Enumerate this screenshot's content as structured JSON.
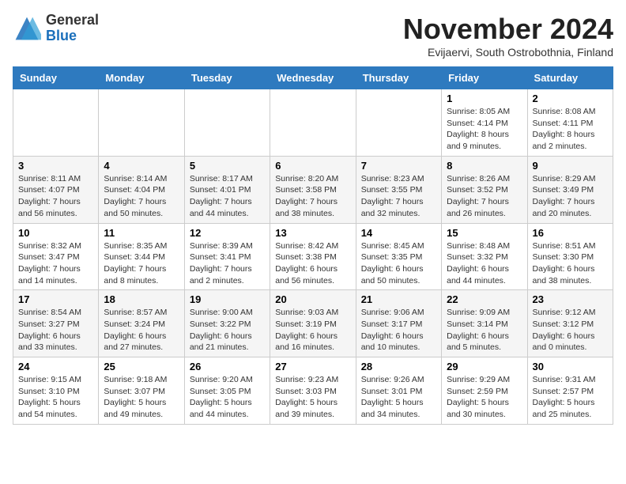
{
  "logo": {
    "general": "General",
    "blue": "Blue"
  },
  "title": "November 2024",
  "subtitle": "Evijaervi, South Ostrobothnia, Finland",
  "days_of_week": [
    "Sunday",
    "Monday",
    "Tuesday",
    "Wednesday",
    "Thursday",
    "Friday",
    "Saturday"
  ],
  "weeks": [
    [
      {
        "day": "",
        "info": ""
      },
      {
        "day": "",
        "info": ""
      },
      {
        "day": "",
        "info": ""
      },
      {
        "day": "",
        "info": ""
      },
      {
        "day": "",
        "info": ""
      },
      {
        "day": "1",
        "info": "Sunrise: 8:05 AM\nSunset: 4:14 PM\nDaylight: 8 hours and 9 minutes."
      },
      {
        "day": "2",
        "info": "Sunrise: 8:08 AM\nSunset: 4:11 PM\nDaylight: 8 hours and 2 minutes."
      }
    ],
    [
      {
        "day": "3",
        "info": "Sunrise: 8:11 AM\nSunset: 4:07 PM\nDaylight: 7 hours and 56 minutes."
      },
      {
        "day": "4",
        "info": "Sunrise: 8:14 AM\nSunset: 4:04 PM\nDaylight: 7 hours and 50 minutes."
      },
      {
        "day": "5",
        "info": "Sunrise: 8:17 AM\nSunset: 4:01 PM\nDaylight: 7 hours and 44 minutes."
      },
      {
        "day": "6",
        "info": "Sunrise: 8:20 AM\nSunset: 3:58 PM\nDaylight: 7 hours and 38 minutes."
      },
      {
        "day": "7",
        "info": "Sunrise: 8:23 AM\nSunset: 3:55 PM\nDaylight: 7 hours and 32 minutes."
      },
      {
        "day": "8",
        "info": "Sunrise: 8:26 AM\nSunset: 3:52 PM\nDaylight: 7 hours and 26 minutes."
      },
      {
        "day": "9",
        "info": "Sunrise: 8:29 AM\nSunset: 3:49 PM\nDaylight: 7 hours and 20 minutes."
      }
    ],
    [
      {
        "day": "10",
        "info": "Sunrise: 8:32 AM\nSunset: 3:47 PM\nDaylight: 7 hours and 14 minutes."
      },
      {
        "day": "11",
        "info": "Sunrise: 8:35 AM\nSunset: 3:44 PM\nDaylight: 7 hours and 8 minutes."
      },
      {
        "day": "12",
        "info": "Sunrise: 8:39 AM\nSunset: 3:41 PM\nDaylight: 7 hours and 2 minutes."
      },
      {
        "day": "13",
        "info": "Sunrise: 8:42 AM\nSunset: 3:38 PM\nDaylight: 6 hours and 56 minutes."
      },
      {
        "day": "14",
        "info": "Sunrise: 8:45 AM\nSunset: 3:35 PM\nDaylight: 6 hours and 50 minutes."
      },
      {
        "day": "15",
        "info": "Sunrise: 8:48 AM\nSunset: 3:32 PM\nDaylight: 6 hours and 44 minutes."
      },
      {
        "day": "16",
        "info": "Sunrise: 8:51 AM\nSunset: 3:30 PM\nDaylight: 6 hours and 38 minutes."
      }
    ],
    [
      {
        "day": "17",
        "info": "Sunrise: 8:54 AM\nSunset: 3:27 PM\nDaylight: 6 hours and 33 minutes."
      },
      {
        "day": "18",
        "info": "Sunrise: 8:57 AM\nSunset: 3:24 PM\nDaylight: 6 hours and 27 minutes."
      },
      {
        "day": "19",
        "info": "Sunrise: 9:00 AM\nSunset: 3:22 PM\nDaylight: 6 hours and 21 minutes."
      },
      {
        "day": "20",
        "info": "Sunrise: 9:03 AM\nSunset: 3:19 PM\nDaylight: 6 hours and 16 minutes."
      },
      {
        "day": "21",
        "info": "Sunrise: 9:06 AM\nSunset: 3:17 PM\nDaylight: 6 hours and 10 minutes."
      },
      {
        "day": "22",
        "info": "Sunrise: 9:09 AM\nSunset: 3:14 PM\nDaylight: 6 hours and 5 minutes."
      },
      {
        "day": "23",
        "info": "Sunrise: 9:12 AM\nSunset: 3:12 PM\nDaylight: 6 hours and 0 minutes."
      }
    ],
    [
      {
        "day": "24",
        "info": "Sunrise: 9:15 AM\nSunset: 3:10 PM\nDaylight: 5 hours and 54 minutes."
      },
      {
        "day": "25",
        "info": "Sunrise: 9:18 AM\nSunset: 3:07 PM\nDaylight: 5 hours and 49 minutes."
      },
      {
        "day": "26",
        "info": "Sunrise: 9:20 AM\nSunset: 3:05 PM\nDaylight: 5 hours and 44 minutes."
      },
      {
        "day": "27",
        "info": "Sunrise: 9:23 AM\nSunset: 3:03 PM\nDaylight: 5 hours and 39 minutes."
      },
      {
        "day": "28",
        "info": "Sunrise: 9:26 AM\nSunset: 3:01 PM\nDaylight: 5 hours and 34 minutes."
      },
      {
        "day": "29",
        "info": "Sunrise: 9:29 AM\nSunset: 2:59 PM\nDaylight: 5 hours and 30 minutes."
      },
      {
        "day": "30",
        "info": "Sunrise: 9:31 AM\nSunset: 2:57 PM\nDaylight: 5 hours and 25 minutes."
      }
    ]
  ]
}
